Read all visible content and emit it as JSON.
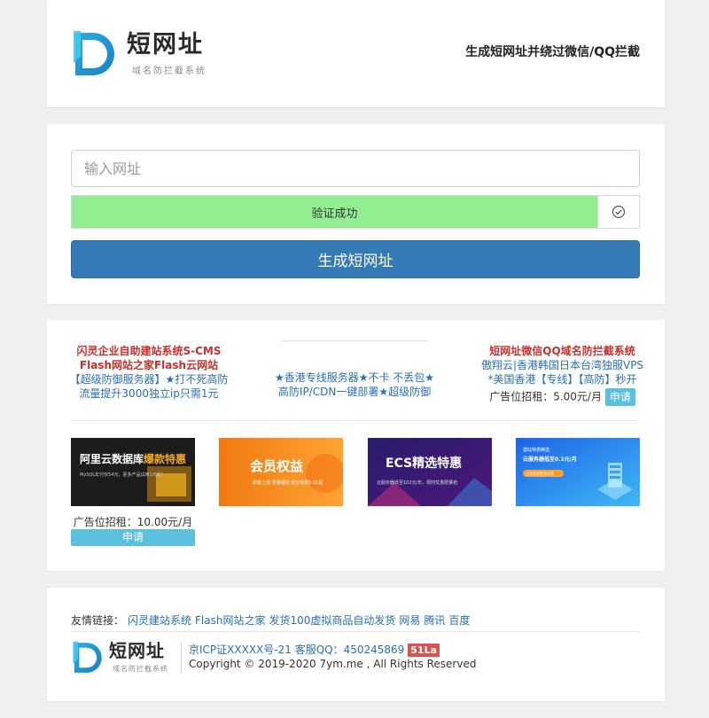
{
  "header": {
    "logo_title": "短网址",
    "logo_subtitle": "域名防拦截系统",
    "slogan": "生成短网址并绕过微信/QQ拦截"
  },
  "form": {
    "url_placeholder": "输入网址",
    "url_value": "",
    "verify_text": "验证成功",
    "generate_label": "生成短网址"
  },
  "ads": {
    "left": {
      "line1": "闪灵企业自助建站系统S-CMS",
      "line2": "Flash网站之家Flash云网站",
      "line3": "【超级防御服务器】★打不死高防",
      "line4": "流量提升3000独立ip只需1元"
    },
    "middle": {
      "line1": "★香港专线服务器★不卡 不丢包★",
      "line2": "高防IP/CDN一键部署★超级防御"
    },
    "right": {
      "line1": "短网址微信QQ域名防拦截系统",
      "line2": "傲翔云|香港韩国日本台湾独服VPS",
      "line3": "*美国香港【专线】【高防】秒开",
      "price_text": "广告位招租：5.00元/月",
      "apply_label": "申请"
    },
    "banners": [
      {
        "title_white": "阿里云数据库",
        "title_hot": "爆款特惠",
        "sub": "MySQL年付仅54元，更多产品试用1元起！"
      },
      {
        "title": "会员权益",
        "sub": "新客上线  限量福利  低价续费0.01起"
      },
      {
        "title": "ECS精选特惠",
        "sub": "云服务器低至102元/年，限时优惠限量抢"
      },
      {
        "line1": "建站特惠精选",
        "line2": "云服务器低至0.1元/月",
        "btn": "立即查看更多优惠"
      }
    ],
    "banner1_price": "广告位招租：10.00元/月",
    "banner1_apply": "申请"
  },
  "footer": {
    "links_label": "友情链接：",
    "links": [
      "闪灵建站系统",
      "Flash网站之家",
      "发货100虚拟商品自动发货",
      "网易",
      "腾讯",
      "百度"
    ],
    "logo_title": "短网址",
    "logo_subtitle": "域名防拦截系统",
    "icp": "京ICP证XXXXX号-21",
    "qq_label": "客服QQ：",
    "qq": "450245869",
    "badge": "51La",
    "copyright": "Copyright © 2019-2020 7ym.me , All Rights Reserved"
  },
  "colors": {
    "primary": "#337ab7",
    "success_fill": "#90ee90",
    "info_button": "#5bc0de",
    "ad_red": "#c9302c",
    "link_blue": "#2a6fb0"
  }
}
